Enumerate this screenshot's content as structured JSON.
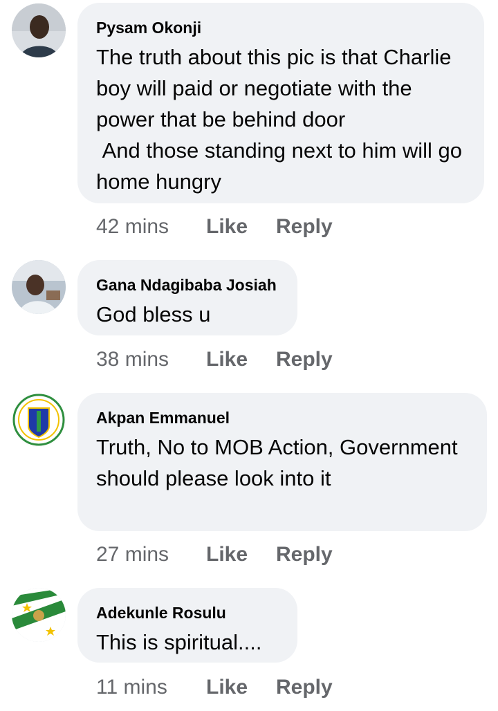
{
  "comments": [
    {
      "author": "Pysam Okonji",
      "text": "The truth about this pic is that Charlie boy will paid or negotiate with the power that be behind door\n And those standing next to him will go home hungry",
      "time": "42 mins",
      "like_label": "Like",
      "reply_label": "Reply"
    },
    {
      "author": "Gana Ndagibaba Josiah",
      "text": "God bless u",
      "time": "38 mins",
      "like_label": "Like",
      "reply_label": "Reply"
    },
    {
      "author": "Akpan Emmanuel",
      "text": "Truth, No to MOB Action, Government should please look into it",
      "time": "27 mins",
      "like_label": "Like",
      "reply_label": "Reply"
    },
    {
      "author": "Adekunle Rosulu",
      "text": "This is spiritual....",
      "time": "11 mins",
      "like_label": "Like",
      "reply_label": "Reply"
    }
  ]
}
